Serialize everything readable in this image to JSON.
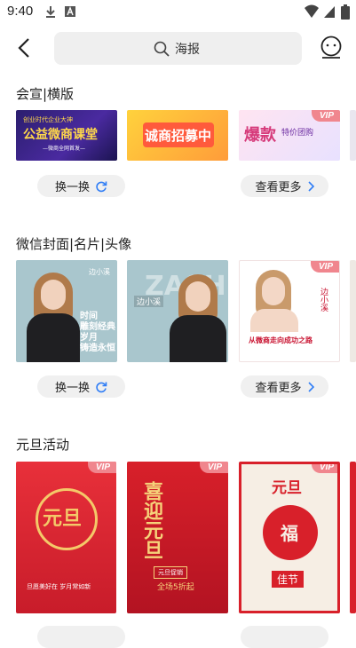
{
  "status_bar": {
    "time": "9:40"
  },
  "header": {
    "search_text": "海报"
  },
  "sections": [
    {
      "title": "会宣|横版",
      "shuffle_label": "换一换",
      "more_label": "查看更多",
      "cards": [
        {
          "line1": "创业时代企业大神",
          "line2": "公益微商课堂",
          "line3": "—微商全网首发—"
        },
        {
          "line1": "诚商招募中"
        },
        {
          "vip": "VIP",
          "line1": "爆款",
          "line2": "特价团购"
        }
      ]
    },
    {
      "title": "微信封面|名片|头像",
      "shuffle_label": "换一换",
      "more_label": "查看更多",
      "cards": [
        {
          "name": "边小溪",
          "line1": "时间",
          "line2": "雕刻经典",
          "line3": "岁月",
          "line4": "铸造永恒"
        },
        {
          "name": "边小溪",
          "bg_text": "ZASH"
        },
        {
          "vip": "VIP",
          "name": "边小溪",
          "line1": "从微商走向成功之路"
        }
      ]
    },
    {
      "title": "元旦活动",
      "cards": [
        {
          "vip": "VIP",
          "main": "元旦",
          "line1": "旦愿美好在 岁月常如新"
        },
        {
          "vip": "VIP",
          "main": "喜迎元旦",
          "line1": "元旦促销",
          "line2": "全场5折起"
        },
        {
          "vip": "VIP",
          "main": "元旦",
          "line1": "福",
          "line2": "佳节"
        }
      ]
    }
  ],
  "colors": {
    "accent_blue": "#2f7df6",
    "vip_pink": "#f0868e",
    "pill_bg": "#f0f0f0"
  }
}
